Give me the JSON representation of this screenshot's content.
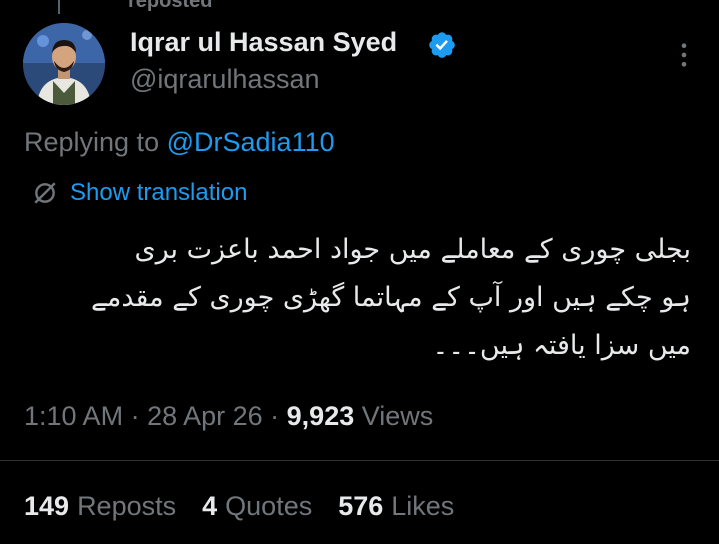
{
  "repost_header": {
    "label": "reposted"
  },
  "author": {
    "name": "Iqrar ul Hassan Syed",
    "handle": "@iqrarulhassan"
  },
  "colors": {
    "accent": "#1d9bf0",
    "muted": "#71767b",
    "text": "#e7e9ea",
    "background": "#000000"
  },
  "reply": {
    "prefix": "Replying to",
    "mention": "@DrSadia110"
  },
  "translate": {
    "label": "Show translation",
    "icon": "translate-icon"
  },
  "tweet": {
    "lines": [
      "بجلی چوری کے معاملے میں جواد احمد باعزت بری",
      "ہو چکے ہیں اور آپ کے مہاتما گھڑی چوری کے مقدمے",
      "میں سزا یافتہ ہیں۔۔۔"
    ]
  },
  "meta": {
    "time": "1:10 AM",
    "sep1": " · ",
    "date": "28 Apr 26",
    "sep2": " · ",
    "views_count": "9,923",
    "views_label": " Views"
  },
  "stats": {
    "reposts_count": "149",
    "reposts_label": "Reposts",
    "quotes_count": "4",
    "quotes_label": "Quotes",
    "likes_count": "576",
    "likes_label": "Likes"
  },
  "icons": {
    "verified": "verified-badge-icon",
    "more": "more-options-icon"
  }
}
